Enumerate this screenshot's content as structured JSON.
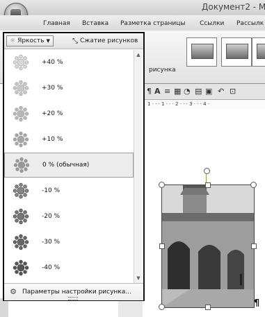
{
  "window": {
    "title": "Документ2 - M"
  },
  "ribbon": {
    "tabs": [
      "Главная",
      "Вставка",
      "Разметка страницы",
      "Ссылки",
      "Рассылк"
    ],
    "group_label": "рисунка"
  },
  "brightness_menu": {
    "dropdown_label": "Яркость",
    "compress_label": "Сжатие рисунков",
    "items": [
      {
        "label": "+40 %",
        "level": 40
      },
      {
        "label": "+30 %",
        "level": 30
      },
      {
        "label": "+20 %",
        "level": 20
      },
      {
        "label": "+10 %",
        "level": 10
      },
      {
        "label": "0 % (обычная)",
        "level": 0,
        "selected": true
      },
      {
        "label": "-10 %",
        "level": -10
      },
      {
        "label": "-20 %",
        "level": -20
      },
      {
        "label": "-30 %",
        "level": -30
      },
      {
        "label": "-40 %",
        "level": -40
      }
    ],
    "footer_label": "Параметры настройки рисунка..."
  },
  "ruler": {
    "text": "1 · · · 1 · · · 2 · · · 3 · · · 4 ·"
  },
  "document": {
    "paragraph_mark": "¶"
  }
}
